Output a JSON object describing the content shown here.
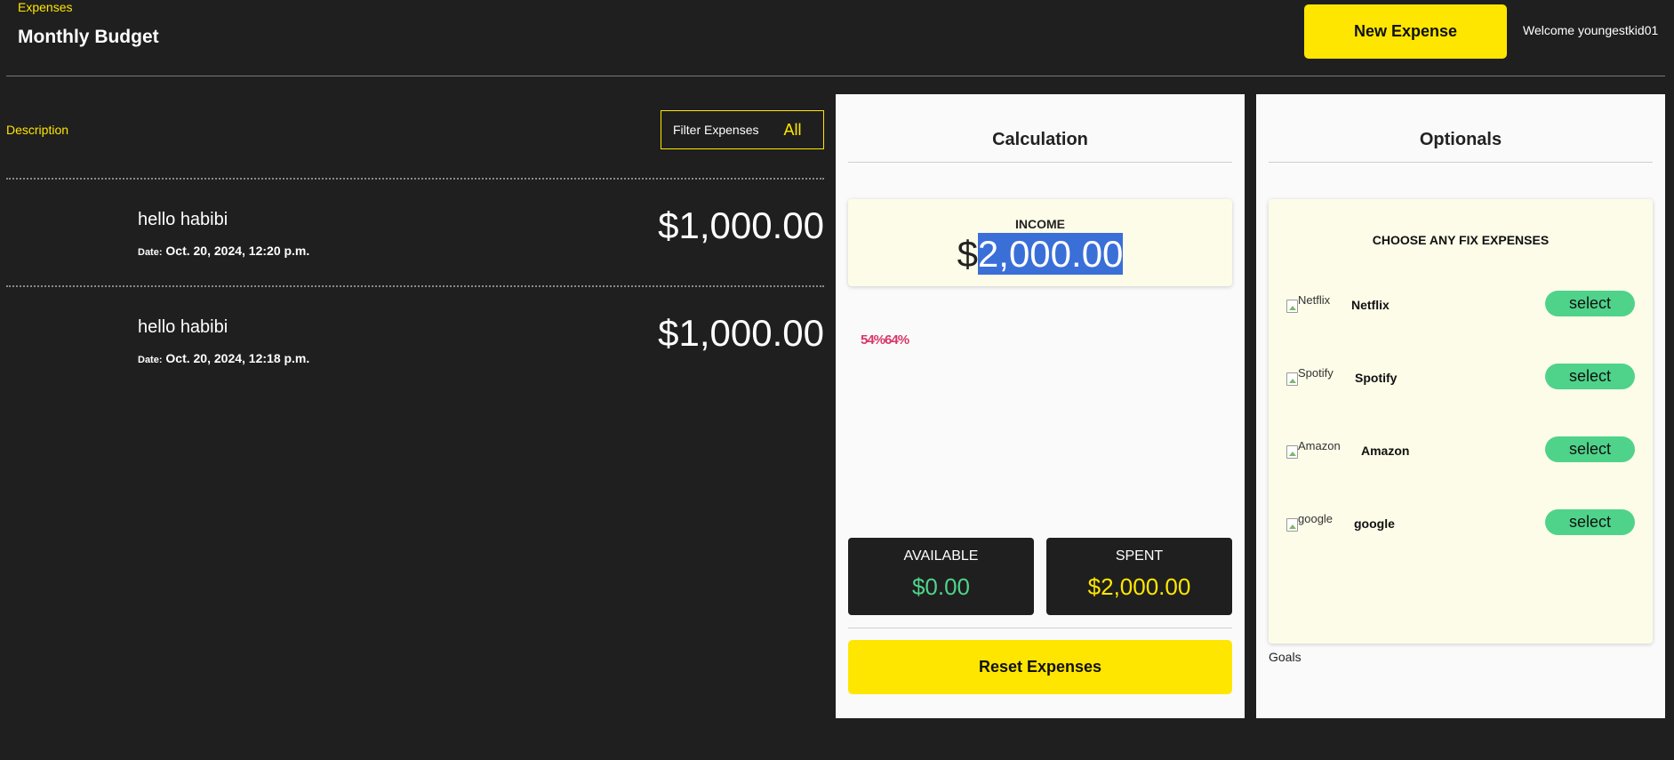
{
  "header": {
    "breadcrumb": "Expenses",
    "title": "Monthly Budget",
    "new_expense_label": "New Expense",
    "welcome": "Welcome youngestkid01"
  },
  "expenses_list": {
    "description_label": "Description",
    "filter_label": "Filter Expenses",
    "filter_value": "All",
    "items": [
      {
        "title": "hello habibi",
        "date_label": "Date:",
        "date": "Oct. 20, 2024, 12:20 p.m.",
        "amount": "$1,000.00"
      },
      {
        "title": "hello habibi",
        "date_label": "Date:",
        "date": "Oct. 20, 2024, 12:18 p.m.",
        "amount": "$1,000.00"
      }
    ]
  },
  "calculation": {
    "title": "Calculation",
    "income_label": "INCOME",
    "income_currency": "$",
    "income_value": "2,000.00",
    "percent_text": "54%64%",
    "available_label": "AVAILABLE",
    "available_value": "$0.00",
    "spent_label": "SPENT",
    "spent_value": "$2,000.00",
    "reset_label": "Reset Expenses"
  },
  "optionals": {
    "title": "Optionals",
    "choose_title": "CHOOSE ANY FIX EXPENSES",
    "items": [
      {
        "alt": "Netflix",
        "name": "Netflix",
        "button": "select"
      },
      {
        "alt": "Spotify",
        "name": "Spotify",
        "button": "select"
      },
      {
        "alt": "Amazon",
        "name": "Amazon",
        "button": "select"
      },
      {
        "alt": "google",
        "name": "google",
        "button": "select"
      }
    ],
    "goals_label": "Goals"
  },
  "colors": {
    "background": "#1f1f1f",
    "accent_yellow": "#ffe600",
    "accent_green": "#4fd38a",
    "panel": "#fafafa",
    "card": "#fdfce8",
    "selection": "#3a6fd8"
  }
}
